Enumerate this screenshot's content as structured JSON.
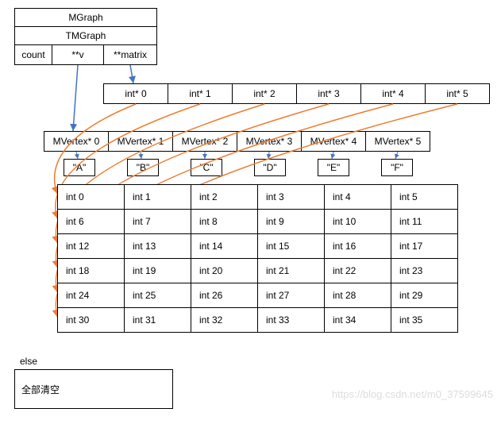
{
  "header": {
    "mgraph": "MGraph",
    "tmgraph": "TMGraph"
  },
  "struct": {
    "count": "count",
    "v": "**v",
    "matrix": "**matrix"
  },
  "intptr": [
    "int* 0",
    "int* 1",
    "int* 2",
    "int* 3",
    "int* 4",
    "int* 5"
  ],
  "mvertex": [
    "MVertex* 0",
    "MVertex* 1",
    "MVertex* 2",
    "MVertex* 3",
    "MVertex* 4",
    "MVertex* 5"
  ],
  "labels": [
    "\"A\"",
    "\"B\"",
    "\"C\"",
    "\"D\"",
    "\"E\"",
    "\"F\""
  ],
  "matrix": [
    [
      "int 0",
      "int 1",
      "int 2",
      "int 3",
      "int 4",
      "int 5"
    ],
    [
      "int 6",
      "int 7",
      "int 8",
      "int 9",
      "int 10",
      "int 11"
    ],
    [
      "int 12",
      "int 13",
      "int 14",
      "int 15",
      "int 16",
      "int 17"
    ],
    [
      "int 18",
      "int 19",
      "int 20",
      "int 21",
      "int 22",
      "int 23"
    ],
    [
      "int 24",
      "int 25",
      "int 26",
      "int 27",
      "int 28",
      "int 29"
    ],
    [
      "int 30",
      "int 31",
      "int 32",
      "int 33",
      "int 34",
      "int 35"
    ]
  ],
  "else_label": "else",
  "clear": "全部清空",
  "watermark": "https://blog.csdn.net/m0_37599645"
}
